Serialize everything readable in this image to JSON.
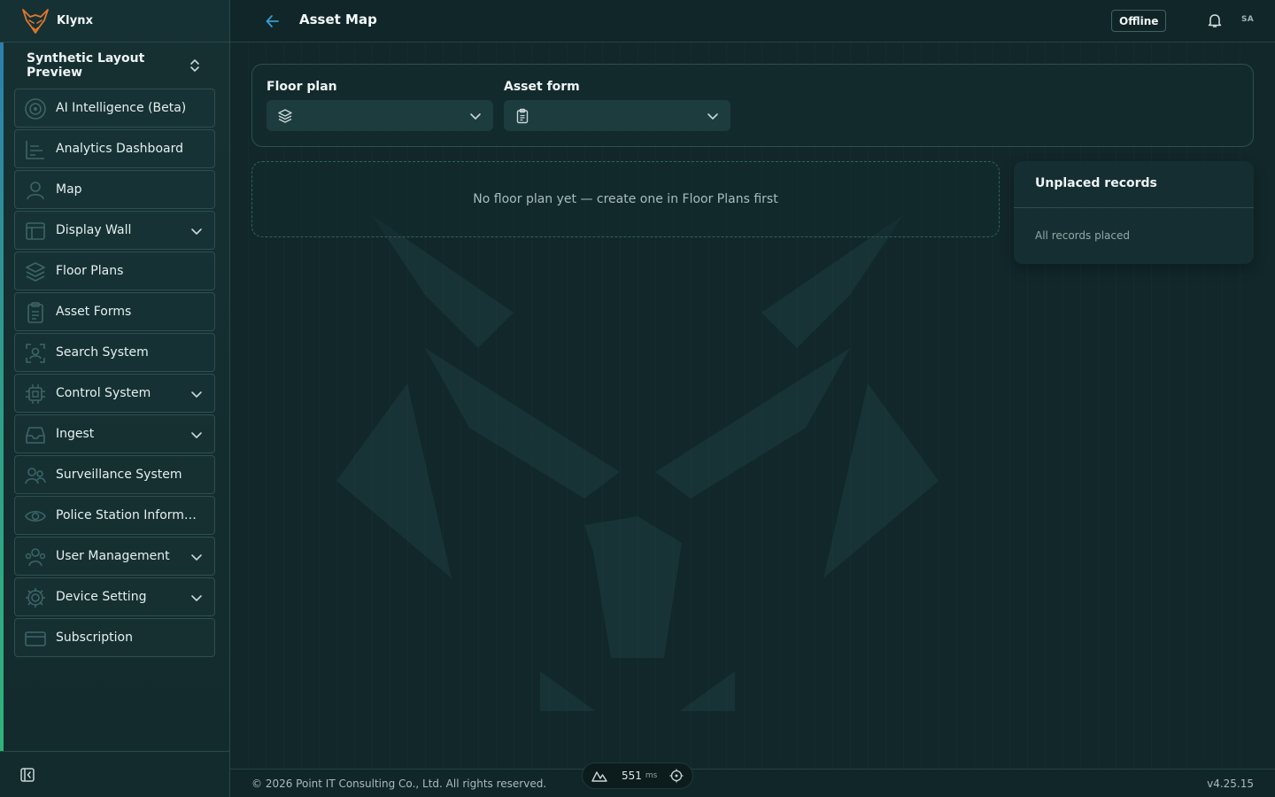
{
  "brand": {
    "name": "Klynx"
  },
  "workspace": {
    "label": "Synthetic Layout Preview"
  },
  "nav": {
    "items": [
      {
        "label": "AI Intelligence (Beta)",
        "icon": "ai-target-icon",
        "expandable": false
      },
      {
        "label": "Analytics Dashboard",
        "icon": "chart-icon",
        "expandable": false
      },
      {
        "label": "Map",
        "icon": "person-pin-icon",
        "expandable": false
      },
      {
        "label": "Display Wall",
        "icon": "layout-icon",
        "expandable": true
      },
      {
        "label": "Floor Plans",
        "icon": "layers-icon",
        "expandable": false
      },
      {
        "label": "Asset Forms",
        "icon": "clipboard-icon",
        "expandable": false
      },
      {
        "label": "Search System",
        "icon": "scan-person-icon",
        "expandable": false
      },
      {
        "label": "Control System",
        "icon": "chip-icon",
        "expandable": true
      },
      {
        "label": "Ingest",
        "icon": "inbox-icon",
        "expandable": true
      },
      {
        "label": "Surveillance System",
        "icon": "people-icon",
        "expandable": false
      },
      {
        "label": "Police Station Informati...",
        "icon": "eye-icon",
        "expandable": false
      },
      {
        "label": "User Management",
        "icon": "users-icon",
        "expandable": true
      },
      {
        "label": "Device Setting",
        "icon": "gear-icon",
        "expandable": true
      },
      {
        "label": "Subscription",
        "icon": "card-icon",
        "expandable": false
      }
    ]
  },
  "header": {
    "title": "Asset Map",
    "status": "Offline",
    "avatar": "SA"
  },
  "selectors": {
    "floor_plan": {
      "label": "Floor plan",
      "value": "",
      "icon": "layers-icon"
    },
    "asset_form": {
      "label": "Asset form",
      "value": "",
      "icon": "clipboard-icon"
    }
  },
  "floor_area": {
    "empty_message": "No floor plan yet — create one in Floor Plans first"
  },
  "unplaced": {
    "title": "Unplaced records",
    "empty_message": "All records placed"
  },
  "footer": {
    "copyright": "© 2026 Point IT Consulting Co., Ltd. All rights reserved.",
    "version": "v4.25.15",
    "latency_value": "551",
    "latency_unit": "ms"
  },
  "colors": {
    "accent_blue": "#3a9ad2",
    "brand_orange": "#e2772c",
    "background": "#112729"
  }
}
